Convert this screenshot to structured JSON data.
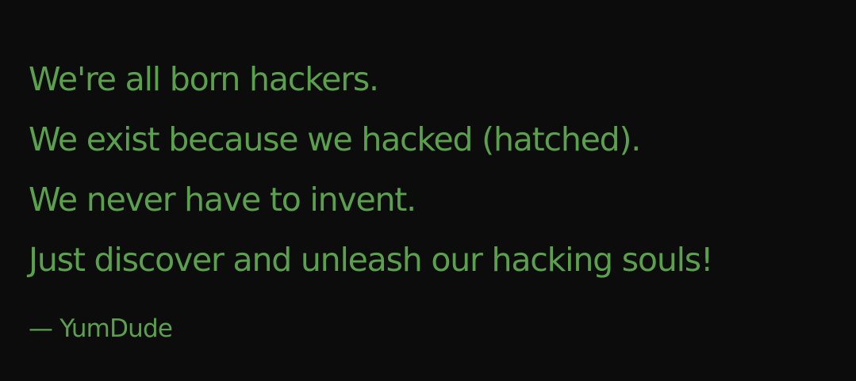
{
  "quote": {
    "lines": [
      "We're all born hackers.",
      "We exist because we hacked (hatched).",
      "We never have to invent.",
      "Just discover and unleash our hacking souls!"
    ],
    "attribution": "— YumDude"
  },
  "colors": {
    "background": "#0c0c0c",
    "text": "#5ba04d"
  }
}
